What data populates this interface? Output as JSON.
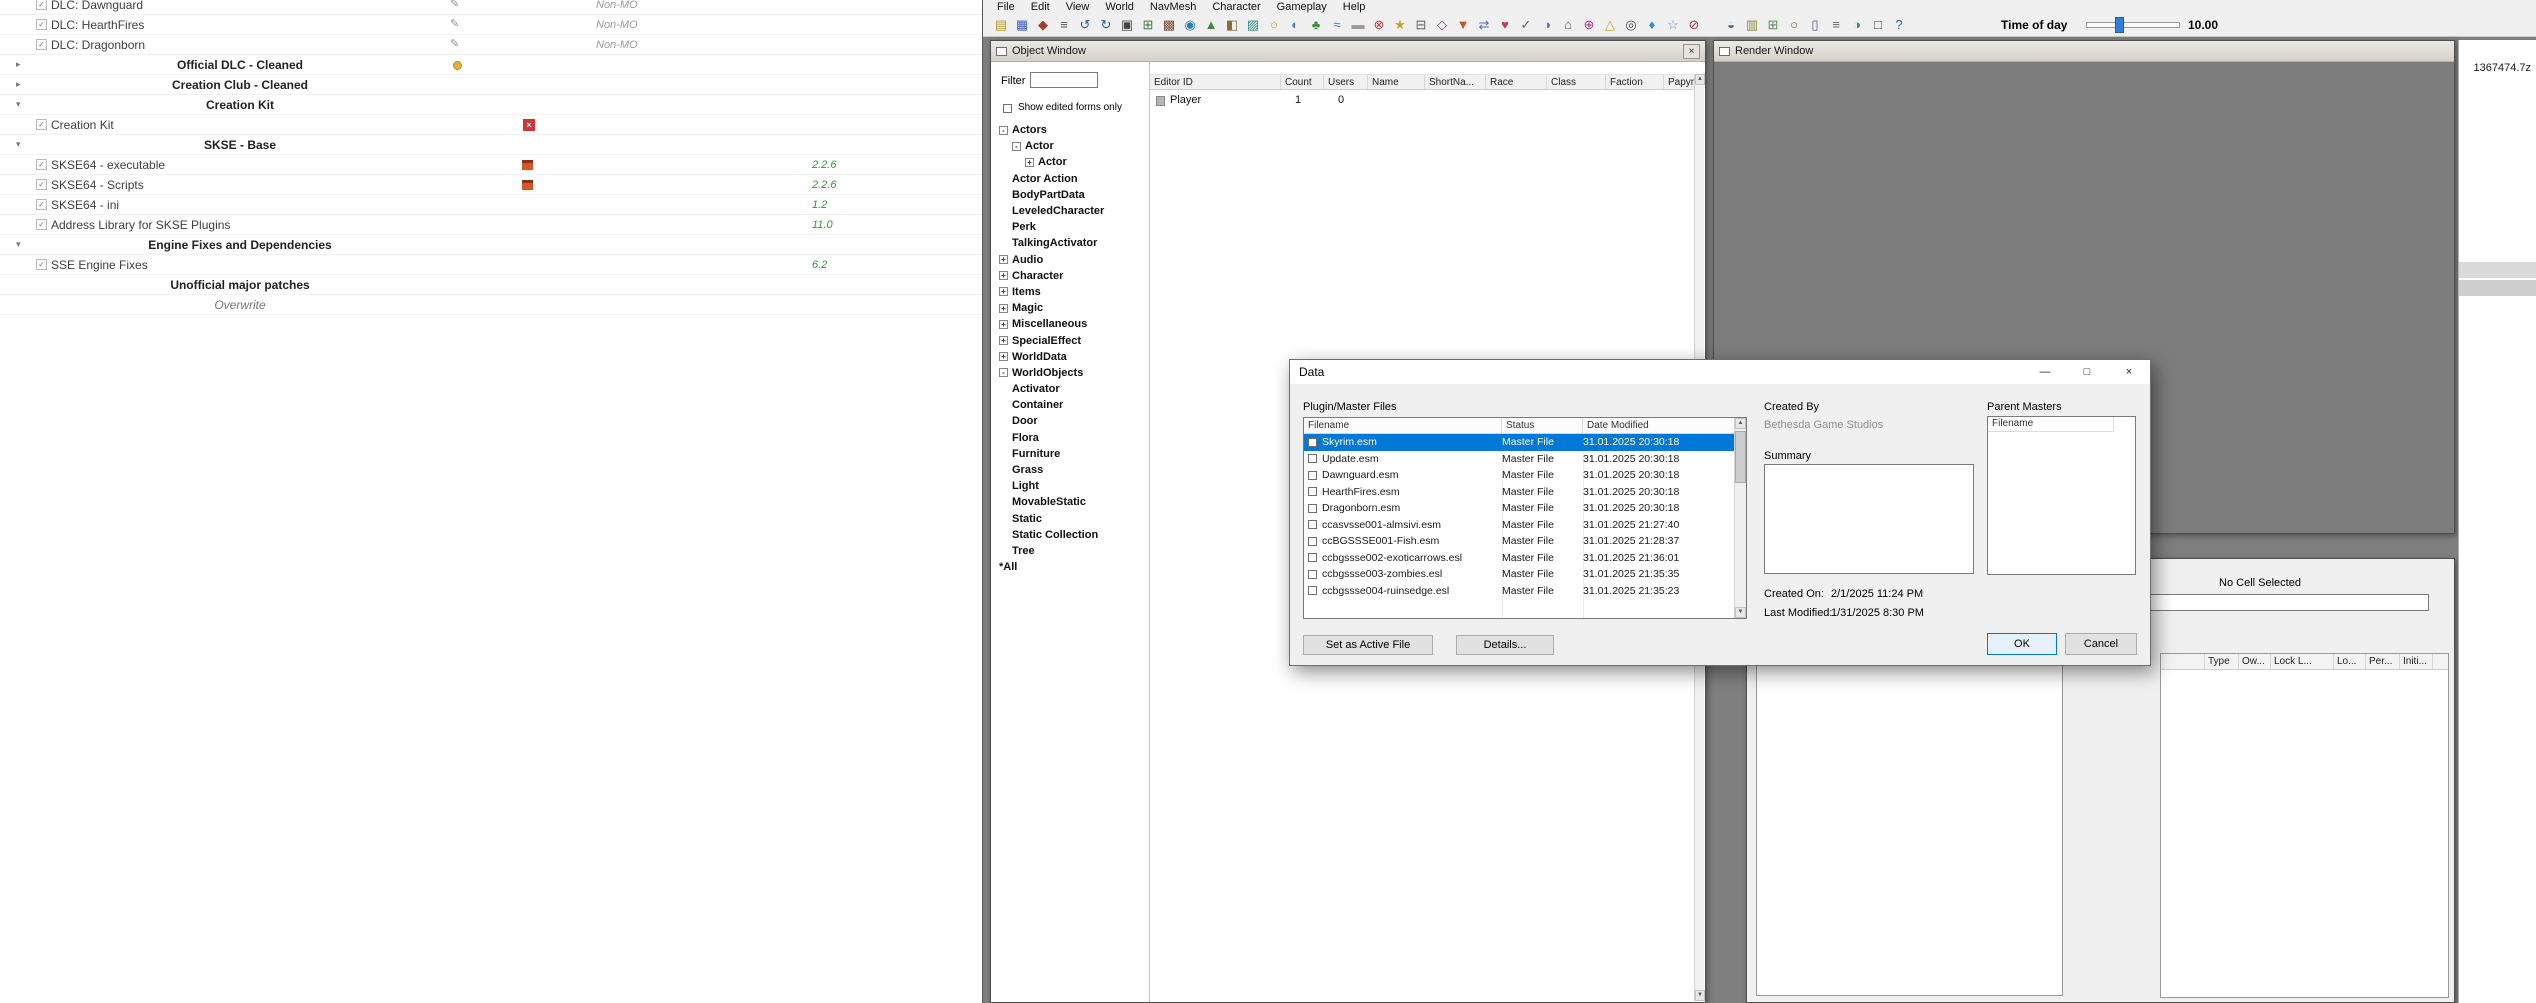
{
  "mo2": {
    "rows": [
      {
        "kind": "mod",
        "label": "DLC: Dawnguard",
        "flag": "feather",
        "category": "Non-MO"
      },
      {
        "kind": "mod",
        "label": "DLC: HearthFires",
        "flag": "feather",
        "category": "Non-MO"
      },
      {
        "kind": "mod",
        "label": "DLC: Dragonborn",
        "flag": "feather",
        "category": "Non-MO"
      },
      {
        "kind": "separator",
        "label": "Official DLC - Cleaned",
        "arrow": "right",
        "flag": "dot"
      },
      {
        "kind": "separator",
        "label": "Creation Club - Cleaned",
        "arrow": "right"
      },
      {
        "kind": "separator",
        "label": "Creation Kit",
        "arrow": "down"
      },
      {
        "kind": "mod",
        "label": "Creation Kit",
        "flag": "redx"
      },
      {
        "kind": "separator",
        "label": "SKSE - Base",
        "arrow": "down"
      },
      {
        "kind": "mod",
        "label": "SKSE64 - executable",
        "flag": "gift",
        "version": "2.2.6"
      },
      {
        "kind": "mod",
        "label": "SKSE64 - Scripts",
        "flag": "gift",
        "version": "2.2.6"
      },
      {
        "kind": "mod",
        "label": "SKSE64 - ini",
        "version": "1.2"
      },
      {
        "kind": "mod",
        "label": "Address Library for SKSE Plugins",
        "version": "11.0"
      },
      {
        "kind": "separator",
        "label": "Engine Fixes and Dependencies",
        "arrow": "down"
      },
      {
        "kind": "mod",
        "label": "SSE Engine Fixes",
        "version": "6.2"
      },
      {
        "kind": "separator",
        "label": "Unofficial major patches"
      },
      {
        "kind": "overwrite",
        "label": "Overwrite"
      }
    ]
  },
  "ck": {
    "menu": [
      "File",
      "Edit",
      "View",
      "World",
      "NavMesh",
      "Character",
      "Gameplay",
      "Help"
    ],
    "toolbar": {
      "time_of_day_label": "Time of day",
      "time_of_day_value": "10.00",
      "icons_a": [
        {
          "name": "open-data",
          "glyph": "▤",
          "color": "#b8962e"
        },
        {
          "name": "save-plugin",
          "glyph": "▦",
          "color": "#3a62c9"
        },
        {
          "name": "version-control",
          "glyph": "◆",
          "color": "#a23c2e"
        },
        {
          "name": "preferences",
          "glyph": "≡",
          "color": "#555555"
        },
        {
          "name": "undo",
          "glyph": "↺",
          "color": "#2f5fae"
        },
        {
          "name": "redo",
          "glyph": "↻",
          "color": "#2f5fae"
        },
        {
          "name": "render-window-toggle",
          "glyph": "▣",
          "color": "#444444"
        },
        {
          "name": "object-window-toggle",
          "glyph": "⊞",
          "color": "#3f7a3f"
        },
        {
          "name": "cell-view-toggle",
          "glyph": "▩",
          "color": "#7a4a3a"
        },
        {
          "name": "world-spaces",
          "glyph": "◉",
          "color": "#2e7dbb"
        },
        {
          "name": "landscape-edit",
          "glyph": "▲",
          "color": "#3f8a3f"
        },
        {
          "name": "object-palettes",
          "glyph": "◧",
          "color": "#8a6a3f"
        },
        {
          "name": "navmesh-mode",
          "glyph": "▨",
          "color": "#2f8f8f"
        },
        {
          "name": "lighting-toggle",
          "glyph": "○",
          "color": "#d8a020"
        },
        {
          "name": "sky-toggle",
          "glyph": "◐",
          "color": "#4f7fd0"
        },
        {
          "name": "grass-toggle",
          "glyph": "♣",
          "color": "#3e8e3e"
        },
        {
          "name": "water-toggle",
          "glyph": "≈",
          "color": "#3a7fd0"
        },
        {
          "name": "fog-toggle",
          "glyph": "▬",
          "color": "#9a9a9a"
        },
        {
          "name": "collision-geometry",
          "glyph": "⊗",
          "color": "#c04040"
        },
        {
          "name": "markers-toggle",
          "glyph": "★",
          "color": "#c7a12e"
        },
        {
          "name": "snap-to-grid",
          "glyph": "⊟",
          "color": "#5f5f5f"
        },
        {
          "name": "snap-to-angle",
          "glyph": "◇",
          "color": "#8a4f8a"
        },
        {
          "name": "run-havok-sim",
          "glyph": "▼",
          "color": "#d04f2e"
        },
        {
          "name": "animations",
          "glyph": "⇄",
          "color": "#5f5fd0"
        },
        {
          "name": "dialogue-view",
          "glyph": "♥",
          "color": "#c03a5f"
        },
        {
          "name": "papyrus-scripts",
          "glyph": "✓",
          "color": "#3f7f3f"
        },
        {
          "name": "material-editor",
          "glyph": "◑",
          "color": "#7a5fc0"
        },
        {
          "name": "archive-export",
          "glyph": "⌂",
          "color": "#6a5a3a"
        },
        {
          "name": "localization",
          "glyph": "⊕",
          "color": "#b03a8a"
        },
        {
          "name": "warnings",
          "glyph": "△",
          "color": "#d0a020"
        },
        {
          "name": "camera-bookmarks",
          "glyph": "◎",
          "color": "#4a4a4a"
        },
        {
          "name": "sound-view",
          "glyph": "♦",
          "color": "#3a8ad0"
        },
        {
          "name": "weather-editor",
          "glyph": "☆",
          "color": "#5f9ad0"
        },
        {
          "name": "effects-editor",
          "glyph": "⊘",
          "color": "#a23c3c"
        }
      ],
      "icons_b": [
        {
          "name": "actor-dialogue",
          "glyph": "◒",
          "color": "#3a6a9a"
        },
        {
          "name": "quest-editor",
          "glyph": "▥",
          "color": "#8a8a3a"
        },
        {
          "name": "ai-packages",
          "glyph": "⊞",
          "color": "#5a8a5a"
        },
        {
          "name": "race-editor",
          "glyph": "○",
          "color": "#9a5a3a"
        },
        {
          "name": "furniture-markers",
          "glyph": "▯",
          "color": "#5a5a9a"
        },
        {
          "name": "leveled-lists",
          "glyph": "≡",
          "color": "#666666"
        },
        {
          "name": "recent-cells",
          "glyph": "◑",
          "color": "#2f8f7f"
        },
        {
          "name": "preview-window",
          "glyph": "□",
          "color": "#444444"
        },
        {
          "name": "help",
          "glyph": "?",
          "color": "#2e5bd7"
        }
      ]
    },
    "object_window": {
      "title": "Object Window",
      "filter_label": "Filter",
      "filter_value": "",
      "show_edited_label": "Show edited forms only",
      "columns": [
        "Editor ID",
        "Count",
        "Users",
        "Name",
        "ShortNa...",
        "Race",
        "Class",
        "Faction",
        "Papyru..."
      ],
      "row": {
        "editor_id": "Player",
        "count": "1",
        "users": "0"
      },
      "tree": [
        {
          "label": "Actors",
          "depth": 0,
          "box": "minus"
        },
        {
          "label": "Actor",
          "depth": 1,
          "box": "minus"
        },
        {
          "label": "Actor",
          "depth": 2,
          "box": "plus"
        },
        {
          "label": "Actor Action",
          "depth": 1
        },
        {
          "label": "BodyPartData",
          "depth": 1
        },
        {
          "label": "LeveledCharacter",
          "depth": 1
        },
        {
          "label": "Perk",
          "depth": 1
        },
        {
          "label": "TalkingActivator",
          "depth": 1
        },
        {
          "label": "Audio",
          "depth": 0,
          "box": "plus"
        },
        {
          "label": "Character",
          "depth": 0,
          "box": "plus"
        },
        {
          "label": "Items",
          "depth": 0,
          "box": "plus"
        },
        {
          "label": "Magic",
          "depth": 0,
          "box": "plus"
        },
        {
          "label": "Miscellaneous",
          "depth": 0,
          "box": "plus"
        },
        {
          "label": "SpecialEffect",
          "depth": 0,
          "box": "plus"
        },
        {
          "label": "WorldData",
          "depth": 0,
          "box": "plus"
        },
        {
          "label": "WorldObjects",
          "depth": 0,
          "box": "minus"
        },
        {
          "label": "Activator",
          "depth": 1
        },
        {
          "label": "Container",
          "depth": 1
        },
        {
          "label": "Door",
          "depth": 1
        },
        {
          "label": "Flora",
          "depth": 1
        },
        {
          "label": "Furniture",
          "depth": 1
        },
        {
          "label": "Grass",
          "depth": 1
        },
        {
          "label": "Light",
          "depth": 1
        },
        {
          "label": "MovableStatic",
          "depth": 1
        },
        {
          "label": "Static",
          "depth": 1
        },
        {
          "label": "Static Collection",
          "depth": 1
        },
        {
          "label": "Tree",
          "depth": 1
        },
        {
          "label": "*All",
          "depth": 0
        }
      ]
    },
    "render_window": {
      "title": "Render Window"
    },
    "cell_view": {
      "no_cell_text": "No Cell Selected",
      "columns": [
        "",
        "Type",
        "Ow...",
        "Lock L...",
        "Lo...",
        "Per...",
        "Initi..."
      ]
    },
    "data_dialog": {
      "title": "Data",
      "plugin_label": "Plugin/Master Files",
      "plugin_columns": [
        "Filename",
        "Status",
        "Date Modified"
      ],
      "files": [
        {
          "name": "Skyrim.esm",
          "status": "Master File",
          "date": "31.01.2025 20:30:18",
          "selected": true
        },
        {
          "name": "Update.esm",
          "status": "Master File",
          "date": "31.01.2025 20:30:18"
        },
        {
          "name": "Dawnguard.esm",
          "status": "Master File",
          "date": "31.01.2025 20:30:18"
        },
        {
          "name": "HearthFires.esm",
          "status": "Master File",
          "date": "31.01.2025 20:30:18"
        },
        {
          "name": "Dragonborn.esm",
          "status": "Master File",
          "date": "31.01.2025 20:30:18"
        },
        {
          "name": "ccasvsse001-almsivi.esm",
          "status": "Master File",
          "date": "31.01.2025 21:27:40"
        },
        {
          "name": "ccBGSSSE001-Fish.esm",
          "status": "Master File",
          "date": "31.01.2025 21:28:37"
        },
        {
          "name": "ccbgssse002-exoticarrows.esl",
          "status": "Master File",
          "date": "31.01.2025 21:36:01"
        },
        {
          "name": "ccbgssse003-zombies.esl",
          "status": "Master File",
          "date": "31.01.2025 21:35:35"
        },
        {
          "name": "ccbgssse004-ruinsedge.esl",
          "status": "Master File",
          "date": "31.01.2025 21:35:23"
        }
      ],
      "created_by_label": "Created By",
      "created_by": "Bethesda Game Studios",
      "summary_label": "Summary",
      "created_on_label": "Created On:",
      "created_on": "2/1/2025  11:24 PM",
      "last_modified_label": "Last Modified:",
      "last_modified": "1/31/2025  8:30 PM",
      "parent_masters_label": "Parent Masters",
      "parent_filename_header": "Filename",
      "buttons": {
        "set_active": "Set as Active File",
        "details": "Details...",
        "ok": "OK",
        "cancel": "Cancel"
      }
    },
    "background_window": {
      "filename": "1367474.7z"
    }
  }
}
